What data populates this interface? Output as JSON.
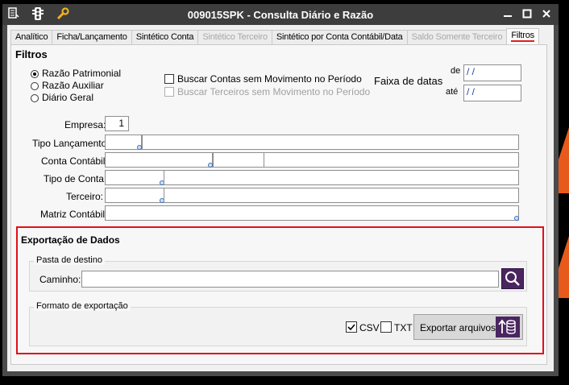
{
  "window": {
    "title": "009015SPK - Consulta Diário e Razão"
  },
  "titlebar_icons": {
    "menu": "menu-icon",
    "tools": "traffic-light-icon",
    "wrench": "wrench-icon"
  },
  "tabs": [
    {
      "label": "Analítico",
      "state": "normal"
    },
    {
      "label": "Ficha/Lançamento",
      "state": "normal"
    },
    {
      "label": "Sintético Conta",
      "state": "normal"
    },
    {
      "label": "Sintético Terceiro",
      "state": "disabled"
    },
    {
      "label": "Sintético por Conta Contábil/Data",
      "state": "normal"
    },
    {
      "label": "Saldo Somente Terceiro",
      "state": "disabled"
    },
    {
      "label": "Filtros",
      "state": "active"
    }
  ],
  "filters": {
    "title": "Filtros",
    "radios": [
      {
        "label": "Razão Patrimonial",
        "checked": true
      },
      {
        "label": "Razão Auxiliar",
        "checked": false
      },
      {
        "label": "Diário Geral",
        "checked": false
      }
    ],
    "checkboxes": [
      {
        "label": "Buscar Contas sem Movimento no Período",
        "checked": false,
        "enabled": true
      },
      {
        "label": "Buscar Terceiros sem Movimento no Período",
        "checked": false,
        "enabled": false
      }
    ],
    "date_range": {
      "label": "Faixa de datas",
      "from_label": "de",
      "to_label": "até",
      "from_value": "/ /",
      "to_value": "/ /"
    },
    "fields": {
      "empresa": {
        "label": "Empresa:",
        "value": "1"
      },
      "tipo_lancamento": {
        "label": "Tipo Lançamento:"
      },
      "conta_contabil": {
        "label": "Conta Contábil:"
      },
      "tipo_conta": {
        "label": "Tipo de Conta:"
      },
      "terceiro": {
        "label": "Terceiro:"
      },
      "matriz_contabil": {
        "label": "Matriz Contábil:"
      }
    }
  },
  "export": {
    "title": "Exportação de Dados",
    "folder_group": "Pasta de destino",
    "path_label": "Caminho:",
    "path_value": "",
    "format_group": "Formato de exportação",
    "csv": {
      "label": "CSV",
      "checked": true
    },
    "txt": {
      "label": "TXT",
      "checked": false
    },
    "export_button": "Exportar arquivos"
  },
  "colors": {
    "highlight": "#e0101a",
    "button_accent": "#4a2560",
    "titlebar": "#3d3d3d"
  }
}
